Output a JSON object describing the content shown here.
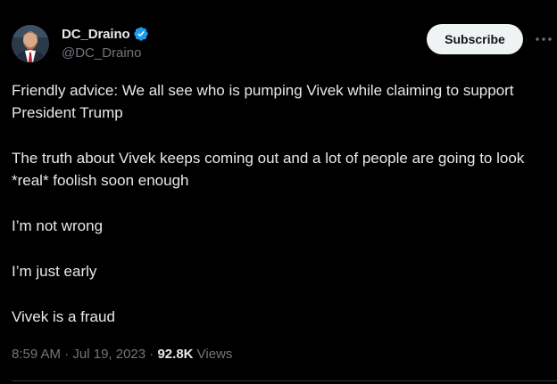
{
  "author": {
    "display_name": "DC_Draino",
    "handle": "@DC_Draino",
    "verified": true,
    "avatar_icon": "profile-photo"
  },
  "actions": {
    "subscribe_label": "Subscribe",
    "more_icon": "more-horizontal-icon"
  },
  "tweet": {
    "paragraphs": [
      "Friendly advice: We all see who is pumping Vivek while claiming to support President Trump",
      "The truth about Vivek keeps coming out and a lot of people are going to look *real* foolish soon enough",
      "I’m not wrong",
      "I’m just early",
      "Vivek is a fraud"
    ]
  },
  "meta": {
    "time": "8:59 AM",
    "separator": "·",
    "date": "Jul 19, 2023",
    "views_count": "92.8K",
    "views_label": "Views"
  },
  "colors": {
    "background": "#000000",
    "text_primary": "#e7e9ea",
    "text_secondary": "#71767b",
    "verified_blue": "#1d9bf0",
    "button_bg": "#eff3f4"
  }
}
